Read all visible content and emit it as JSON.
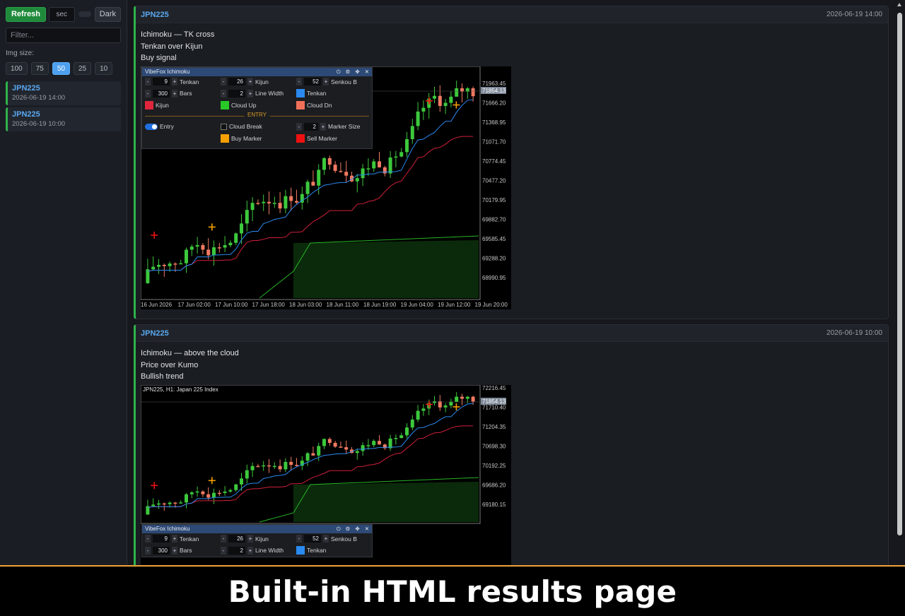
{
  "sidebar": {
    "refresh_label": "Refresh",
    "seconds_placeholder": "sec",
    "theme_label": "Dark",
    "filter_placeholder": "Filter...",
    "img_size_label": "Img size:",
    "img_sizes": [
      "100",
      "75",
      "50",
      "25",
      "10"
    ],
    "img_size_selected": "50",
    "items": [
      {
        "symbol": "JPN225",
        "timestamp": "2026-06-19 14:00"
      },
      {
        "symbol": "JPN225",
        "timestamp": "2026-06-19 10:00"
      }
    ]
  },
  "cards": [
    {
      "symbol": "JPN225",
      "timestamp": "2026-06-19 14:00",
      "lines": [
        "Ichimoku — TK cross",
        "Tenkan over Kijun",
        "Buy signal"
      ],
      "chart": {
        "price_labels": [
          "71963.45",
          "71666.20",
          "71368.95",
          "71071.70",
          "70774.45",
          "70477.20",
          "70179.95",
          "69882.70",
          "69585.45",
          "69288.20",
          "68990.95"
        ],
        "current_price": "71854.13",
        "time_labels": [
          "16 Jun 2026",
          "17 Jun 02:00",
          "17 Jun 10:00",
          "17 Jun 18:00",
          "18 Jun 03:00",
          "18 Jun 11:00",
          "18 Jun 19:00",
          "19 Jun 04:00",
          "19 Jun 12:00",
          "19 Jun 20:00"
        ]
      }
    },
    {
      "symbol": "JPN225",
      "timestamp": "2026-06-19 10:00",
      "lines": [
        "Ichimoku — above the cloud",
        "Price over Kumo",
        "Bullish trend"
      ],
      "chart": {
        "header": "JPN225, H1:  Japan 225 Index",
        "price_labels": [
          "72216.45",
          "71710.40",
          "71204.35",
          "70698.30",
          "70192.25",
          "69686.20",
          "69180.15"
        ],
        "current_price": "71854.13"
      }
    }
  ],
  "panel": {
    "title": "VibeFox Ichimoku",
    "tenkan_value": "9",
    "tenkan_label": "Tenkan",
    "kijun_value": "26",
    "kijun_label": "Kijun",
    "senkou_value": "52",
    "senkou_label": "Senkou B",
    "bars_value": "300",
    "bars_label": "Bars",
    "linewidth_value": "2",
    "linewidth_label": "Line Width",
    "tenkan_color_label": "Tenkan",
    "kijun_color_label": "Kijun",
    "cloud_up_label": "Cloud Up",
    "cloud_dn_label": "Cloud Dn",
    "entry_section": "ENTRY",
    "entry_label": "Entry",
    "cloud_break_label": "Cloud Break",
    "marker_size_value": "2",
    "marker_size_label": "Marker Size",
    "buy_marker_label": "Buy Marker",
    "sell_marker_label": "Sell Marker",
    "minus": "-",
    "plus": "+",
    "colors": {
      "kijun": "#e0263d",
      "cloud_up": "#27c927",
      "cloud_dn": "#f0705a",
      "tenkan": "#2a8af0",
      "buy_marker": "#f5a000",
      "sell_marker": "#ee1111"
    }
  },
  "caption": "Built-in HTML results page",
  "colors": {
    "accent": "#2fb34c",
    "symbol": "#5aa8f0",
    "caption_border": "#f0a33a"
  }
}
